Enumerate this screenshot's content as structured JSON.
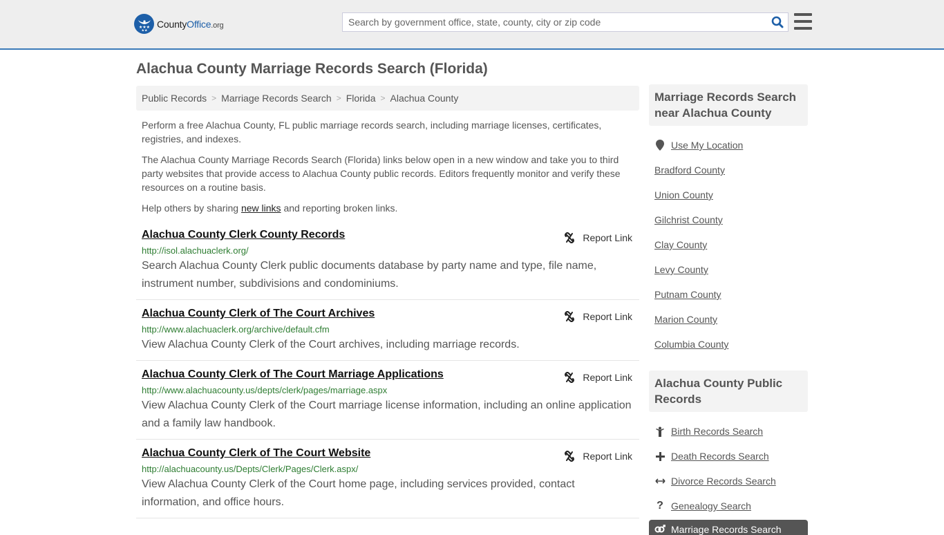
{
  "header": {
    "logo": {
      "county": "County",
      "office": "Office",
      "org": ".org"
    },
    "search": {
      "placeholder": "Search by government office, state, county, city or zip code",
      "value": ""
    }
  },
  "page_title": "Alachua County Marriage Records Search (Florida)",
  "breadcrumb": [
    "Public Records",
    "Marriage Records Search",
    "Florida",
    "Alachua County"
  ],
  "intro": {
    "p1": "Perform a free Alachua County, FL public marriage records search, including marriage licenses, certificates, registries, and indexes.",
    "p2": "The Alachua County Marriage Records Search (Florida) links below open in a new window and take you to third party websites that provide access to Alachua County public records. Editors frequently monitor and verify these resources on a routine basis.",
    "p3_before": "Help others by sharing ",
    "p3_link": "new links",
    "p3_after": " and reporting broken links."
  },
  "report_label": "Report Link",
  "results": [
    {
      "title": "Alachua County Clerk County Records",
      "url": "http://isol.alachuaclerk.org/",
      "desc": "Search Alachua County Clerk public documents database by party name and type, file name, instrument number, subdivisions and condominiums."
    },
    {
      "title": "Alachua County Clerk of The Court Archives",
      "url": "http://www.alachuaclerk.org/archive/default.cfm",
      "desc": "View Alachua County Clerk of the Court archives, including marriage records."
    },
    {
      "title": "Alachua County Clerk of The Court Marriage Applications",
      "url": "http://www.alachuacounty.us/depts/clerk/pages/marriage.aspx",
      "desc": "View Alachua County Clerk of the Court marriage license information, including an online application and a family law handbook."
    },
    {
      "title": "Alachua County Clerk of The Court Website",
      "url": "http://alachuacounty.us/Depts/Clerk/Pages/Clerk.aspx/",
      "desc": "View Alachua County Clerk of the Court home page, including services provided, contact information, and office hours."
    }
  ],
  "sidebar": {
    "nearby": {
      "heading": "Marriage Records Search near Alachua County",
      "use_location": "Use My Location",
      "counties": [
        "Bradford County",
        "Union County",
        "Gilchrist County",
        "Clay County",
        "Levy County",
        "Putnam County",
        "Marion County",
        "Columbia County"
      ]
    },
    "public_records": {
      "heading": "Alachua County Public Records",
      "items": [
        {
          "label": "Birth Records Search",
          "icon": "child-icon"
        },
        {
          "label": "Death Records Search",
          "icon": "cross-icon"
        },
        {
          "label": "Divorce Records Search",
          "icon": "arrows-horizontal-icon"
        },
        {
          "label": "Genealogy Search",
          "icon": "question-icon"
        }
      ],
      "active": {
        "label": "Marriage Records Search",
        "icon": "gender-icon"
      }
    }
  },
  "colors": {
    "brand_blue": "#1d5fa8",
    "header_border": "#3a7ab8",
    "url_green": "#2e7d32"
  }
}
